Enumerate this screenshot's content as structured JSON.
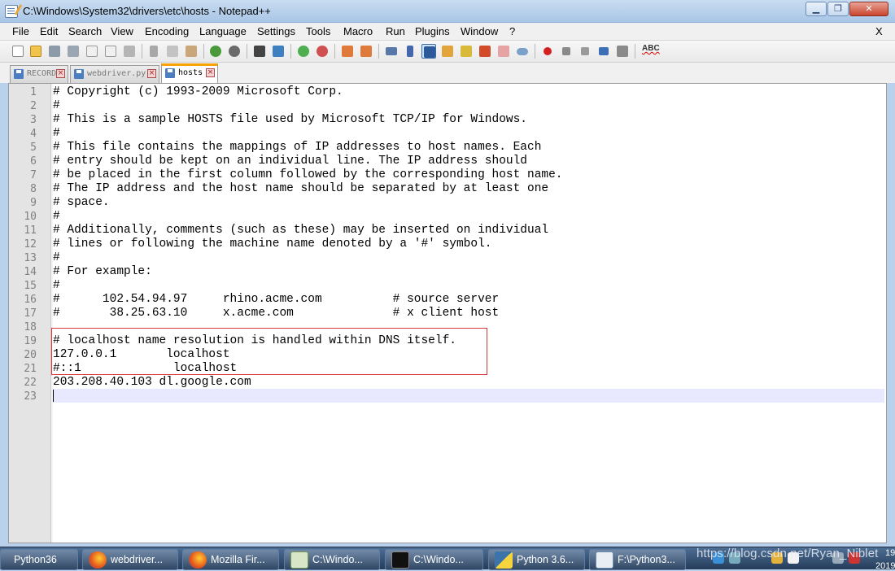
{
  "window": {
    "title": "C:\\Windows\\System32\\drivers\\etc\\hosts - Notepad++",
    "minimize_glyph": "▁",
    "maximize_glyph": "❐",
    "close_glyph": "✕"
  },
  "menu": {
    "items": [
      "File",
      "Edit",
      "Search",
      "View",
      "Encoding",
      "Language",
      "Settings",
      "Tools",
      "Macro",
      "Run",
      "Plugins",
      "Window",
      "?"
    ],
    "close_label": "X"
  },
  "toolbar": {
    "spellcheck_label": "ABC",
    "icons": [
      "new-file-icon",
      "open-file-icon",
      "save-icon",
      "save-all-icon",
      "close-icon",
      "close-all-icon",
      "print-icon",
      "cut-icon",
      "copy-icon",
      "paste-icon",
      "undo-icon",
      "redo-icon",
      "find-icon",
      "replace-icon",
      "zoom-in-icon",
      "zoom-out-icon",
      "sync-vertical-icon",
      "sync-horizontal-icon",
      "word-wrap-icon",
      "show-all-chars-icon",
      "indent-guide-icon",
      "document-map-icon",
      "function-list-icon",
      "folder-workspace-icon",
      "monitoring-icon",
      "record-macro-icon",
      "stop-macro-icon",
      "play-macro-icon",
      "run-macro-multiple-icon",
      "save-macro-icon"
    ]
  },
  "tabs": [
    {
      "label": "RECORD",
      "active": false
    },
    {
      "label": "webdriver.py",
      "active": false
    },
    {
      "label": "hosts",
      "active": true
    }
  ],
  "editor": {
    "lines": [
      "# Copyright (c) 1993-2009 Microsoft Corp.",
      "#",
      "# This is a sample HOSTS file used by Microsoft TCP/IP for Windows.",
      "#",
      "# This file contains the mappings of IP addresses to host names. Each",
      "# entry should be kept on an individual line. The IP address should",
      "# be placed in the first column followed by the corresponding host name.",
      "# The IP address and the host name should be separated by at least one",
      "# space.",
      "#",
      "# Additionally, comments (such as these) may be inserted on individual",
      "# lines or following the machine name denoted by a '#' symbol.",
      "#",
      "# For example:",
      "#",
      "#      102.54.94.97     rhino.acme.com          # source server",
      "#       38.25.63.10     x.acme.com              # x client host",
      "",
      "# localhost name resolution is handled within DNS itself.",
      "127.0.0.1       localhost",
      "#::1             localhost",
      "203.208.40.103 dl.google.com",
      ""
    ],
    "line_numbers": [
      "1",
      "2",
      "3",
      "4",
      "5",
      "6",
      "7",
      "8",
      "9",
      "10",
      "11",
      "12",
      "13",
      "14",
      "15",
      "16",
      "17",
      "18",
      "19",
      "20",
      "21",
      "22",
      "23"
    ],
    "current_line": 23,
    "highlight_color": "#d9383a",
    "highlighted_lines": [
      19,
      21
    ]
  },
  "taskbar": {
    "items": [
      {
        "label": "Python36",
        "icon": "folder-icon"
      },
      {
        "label": "webdriver...",
        "icon": "firefox-icon"
      },
      {
        "label": "Mozilla Fir...",
        "icon": "firefox-icon"
      },
      {
        "label": "C:\\Windo...",
        "icon": "notepad-plus-plus-icon"
      },
      {
        "label": "C:\\Windo...",
        "icon": "command-prompt-icon"
      },
      {
        "label": "Python 3.6...",
        "icon": "python-icon"
      },
      {
        "label": "F:\\Python3...",
        "icon": "window-icon"
      }
    ],
    "watermark": "https://blog.csdn.net/Ryan_Niblet",
    "clock_time": "19",
    "clock_date": "2019"
  }
}
